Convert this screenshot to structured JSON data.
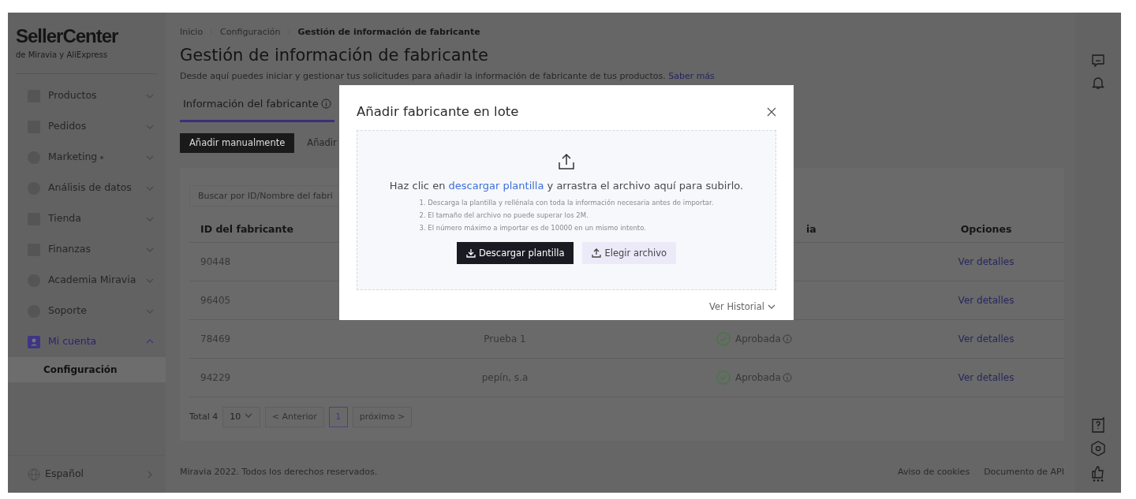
{
  "app": {
    "logo": "SellerCenter",
    "logo_subtitle": "de Miravia y AliExpress"
  },
  "sidebar": {
    "items": [
      {
        "label": "Productos",
        "dot": false,
        "expanded": false,
        "selected": false
      },
      {
        "label": "Pedidos",
        "dot": false,
        "expanded": false,
        "selected": false
      },
      {
        "label": "Marketing",
        "dot": true,
        "expanded": false,
        "selected": false
      },
      {
        "label": "Análisis de datos",
        "dot": false,
        "expanded": false,
        "selected": false
      },
      {
        "label": "Tienda",
        "dot": false,
        "expanded": false,
        "selected": false
      },
      {
        "label": "Finanzas",
        "dot": false,
        "expanded": false,
        "selected": false
      },
      {
        "label": "Academia Miravia",
        "dot": false,
        "expanded": false,
        "selected": false
      },
      {
        "label": "Soporte",
        "dot": false,
        "expanded": false,
        "selected": false
      },
      {
        "label": "Mi cuenta",
        "dot": false,
        "expanded": true,
        "selected": true,
        "children": [
          {
            "label": "Configuración",
            "selected": true
          }
        ]
      }
    ],
    "language": "Español"
  },
  "breadcrumb": [
    {
      "label": "Inicio",
      "current": false
    },
    {
      "label": "Configuración",
      "current": false
    },
    {
      "label": "Gestión de información de fabricante",
      "current": true
    }
  ],
  "page": {
    "title": "Gestión de información de fabricante",
    "description": "Desde aquí puedes iniciar y gestionar tus solicitudes para añadir la información de fabricante de tus productos.",
    "learn_more": "Saber más"
  },
  "tabs": [
    {
      "label": "Información del fabricante",
      "selected": true
    }
  ],
  "actions": [
    {
      "label": "Añadir manualmente",
      "kind": "primary"
    },
    {
      "label": "Añadir",
      "kind": "text"
    }
  ],
  "search": {
    "placeholder": "Buscar por ID/Nombre del fabri"
  },
  "table": {
    "columns": {
      "column_1": "ID del fabricante",
      "column_3": "ia",
      "column_4": "Opciones"
    },
    "rows": [
      {
        "id": "90448",
        "options": "Ver detalles"
      },
      {
        "id": "96405",
        "options": "Ver detalles"
      },
      {
        "id": "78469",
        "name": "Prueba 1",
        "status": "Aprobada",
        "options": "Ver detalles"
      },
      {
        "id": "94229",
        "name": "pepín, s.a",
        "status": "Aprobada",
        "options": "Ver detalles"
      }
    ]
  },
  "pagination": {
    "total": "Total 4",
    "page_size": "10",
    "prev": {
      "label": "< Anterior",
      "disabled": true
    },
    "pages": [
      {
        "label": "1",
        "selected": true
      }
    ],
    "next": {
      "label": "próximo >",
      "disabled": true
    }
  },
  "footer": {
    "copyright": "Miravia 2022. Todos los derechos reservados.",
    "links": [
      "Aviso de cookies",
      "Documento de API"
    ]
  },
  "modal": {
    "title": "Añadir fabricante en lote",
    "prompt_before": "Haz clic en ",
    "prompt_link": "descargar plantilla",
    "prompt_after": " y arrastra el archivo aquí para subirlo.",
    "instructions": [
      "1. Descarga la plantilla y rellénala con toda la información necesaria antes de importar.",
      "2. El tamaño del archivo no puede superar los 2M.",
      "3. El número máximo a importar es de 10000 en un mismo intento."
    ],
    "buttons": [
      {
        "label": "Descargar plantilla",
        "kind": "primary"
      },
      {
        "label": "Elegir archivo",
        "kind": "secondary"
      }
    ],
    "history": "Ver Historial"
  }
}
